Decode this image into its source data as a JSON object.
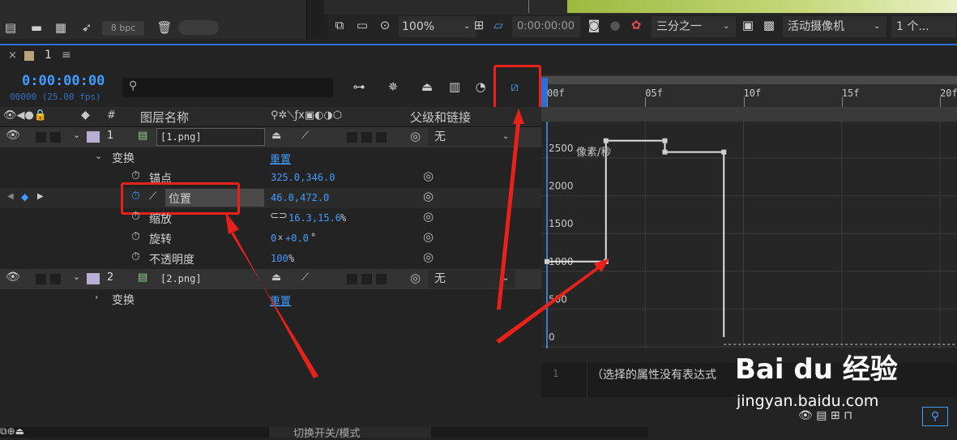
{
  "toolbar": {
    "bpc_label": "8 bpc"
  },
  "viewer": {
    "zoom": "100%",
    "timecode": "0:00:00:00",
    "resolution": "三分之一",
    "camera": "活动摄像机",
    "views": "1 个..."
  },
  "comp": {
    "tab_label": "1"
  },
  "timeline": {
    "current_time": "0:00:00:00",
    "fps_label": "00000 (25.00 fps)",
    "search_placeholder": ""
  },
  "columns": {
    "hash": "#",
    "layer_name": "图层名称",
    "parent": "父级和链接"
  },
  "layers": [
    {
      "index": "1",
      "name": "[1.png]",
      "parent": "无"
    },
    {
      "index": "2",
      "name": "[2.png]",
      "parent": "无"
    }
  ],
  "transform": {
    "label": "变换",
    "reset": "重置",
    "anchor_label": "锚点",
    "anchor_value": "325.0,346.0",
    "position_label": "位置",
    "position_value": "46.0,472.0",
    "scale_label": "缩放",
    "scale_value": "16.3,15.6",
    "scale_unit": "%",
    "rotation_label": "旋转",
    "rotation_value": "0",
    "rotation_x": "x",
    "rotation_deg": "+0.0",
    "rotation_deg_sign": "°",
    "opacity_label": "不透明度",
    "opacity_value": "100",
    "opacity_unit": "%"
  },
  "ruler": {
    "labels": [
      "00f",
      "05f",
      "10f",
      "15f",
      "20f"
    ]
  },
  "graph": {
    "y_unit": "像素/秒",
    "y_labels": [
      "2500",
      "2000",
      "1500",
      "1000",
      "500",
      "0"
    ]
  },
  "chart_data": {
    "type": "line",
    "title": "",
    "ylabel": "像素/秒",
    "x_ticks": [
      "00f",
      "05f",
      "10f",
      "15f",
      "20f"
    ],
    "ylim": [
      0,
      2500
    ],
    "series": [
      {
        "x": [
          0,
          3,
          3,
          6,
          6,
          9,
          9
        ],
        "y": [
          1000,
          1000,
          2600,
          2600,
          2450,
          2450,
          0
        ]
      }
    ]
  },
  "expression": {
    "line_no": "1",
    "text": "（选择的属性没有表达式"
  },
  "bottom": {
    "mode_label": "切换开关/模式"
  },
  "watermark": {
    "logo": "Bai du 经验",
    "url": "jingyan.baidu.com"
  },
  "colors": {
    "accent": "#3f9cff",
    "highlight": "#e8221b",
    "panel": "#232323"
  }
}
